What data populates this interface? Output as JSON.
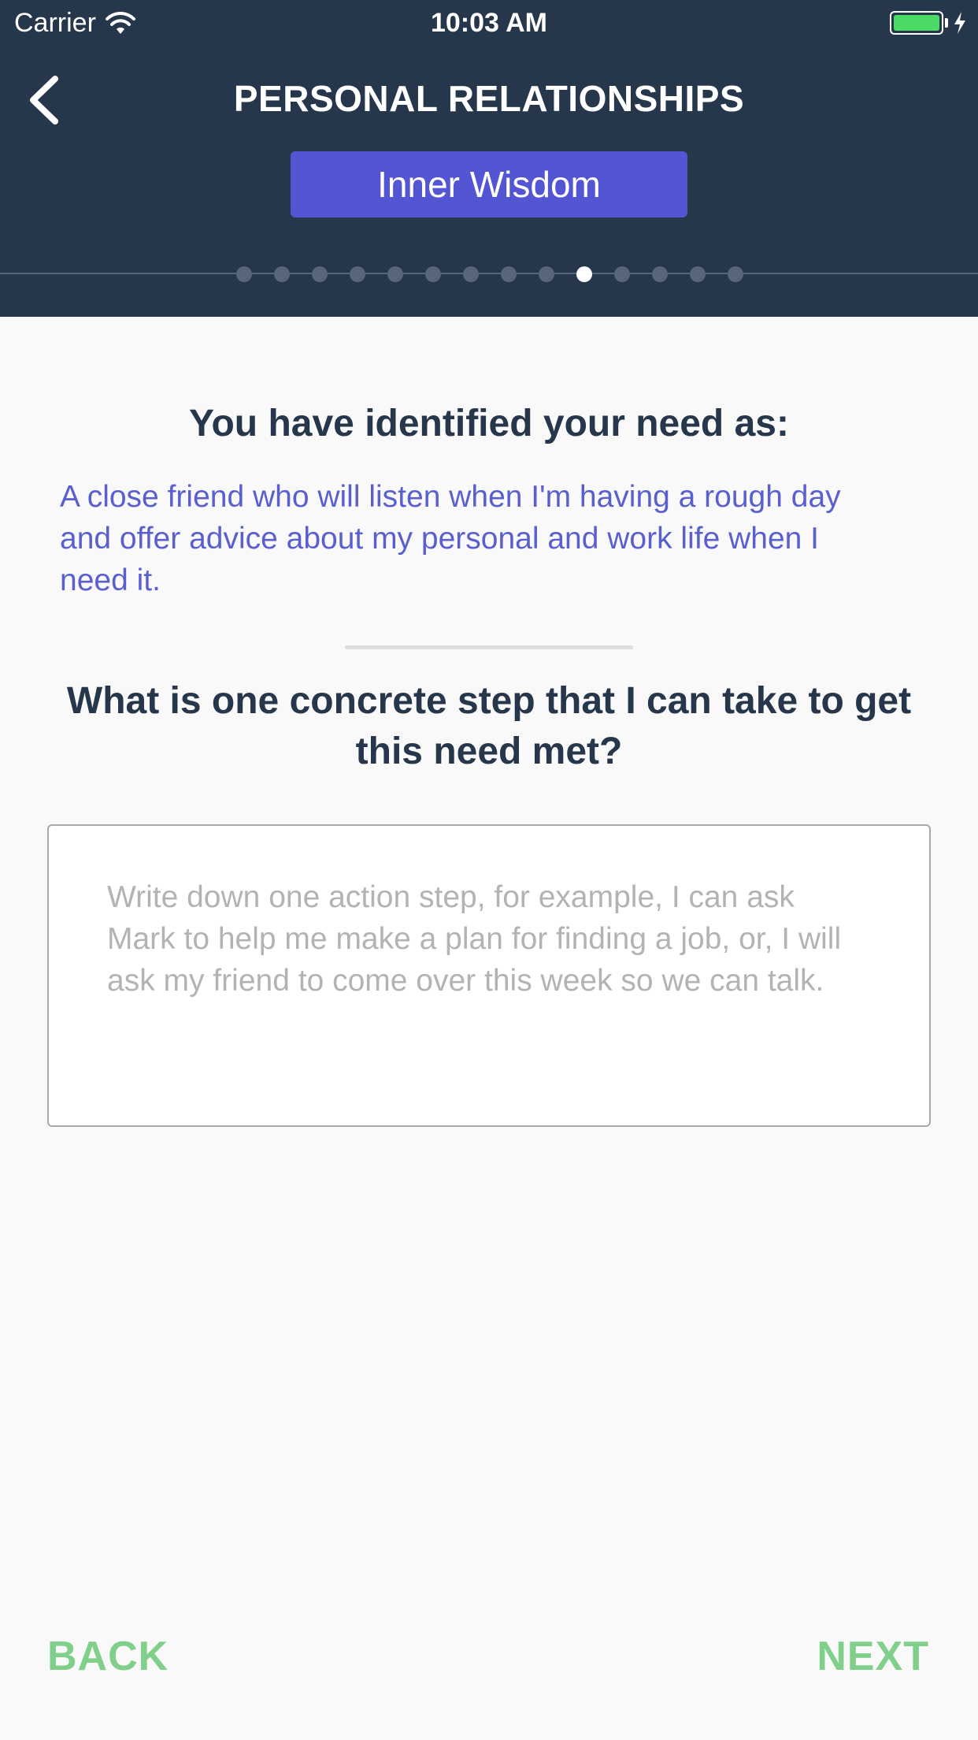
{
  "status_bar": {
    "carrier": "Carrier",
    "time": "10:03 AM",
    "battery_color": "#4cd964"
  },
  "header": {
    "title": "PERSONAL RELATIONSHIPS",
    "category": "Inner Wisdom",
    "background_color": "#26364b",
    "accent_color": "#5355d3"
  },
  "progress": {
    "total_steps": 14,
    "current_step": 10
  },
  "content": {
    "intro_heading": "You have identified your need as:",
    "need_text": "A close friend who will listen when I'm having a rough day and offer advice about my personal and work life when I need it.",
    "question": "What is one concrete step that I can take to get this need met?",
    "answer_value": "",
    "answer_placeholder": "Write down one action step, for example, I can ask Mark to help me make a plan for finding a job, or, I will ask my friend to come over this week so we can talk."
  },
  "footer": {
    "back_label": "BACK",
    "next_label": "NEXT",
    "button_color": "#80cf8b"
  },
  "icons": {
    "back": "chevron-left-icon",
    "wifi": "wifi-icon",
    "battery": "battery-icon",
    "charging": "bolt-icon"
  }
}
